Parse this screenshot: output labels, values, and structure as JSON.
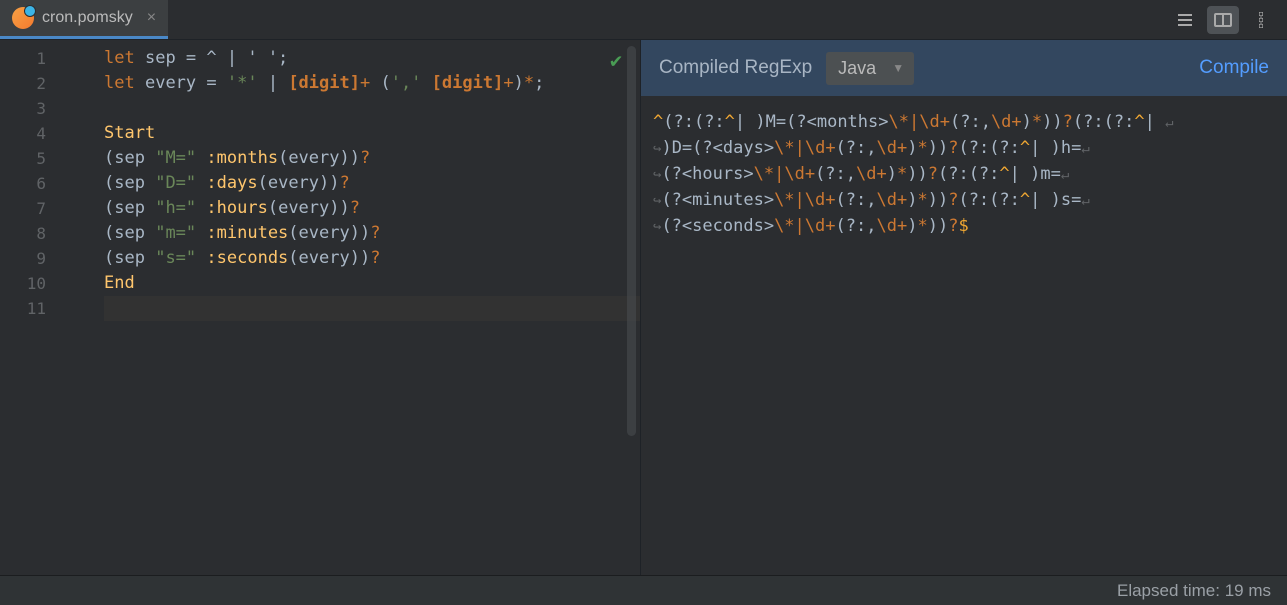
{
  "tab": {
    "filename": "cron.pomsky"
  },
  "editor": {
    "line_count": 11,
    "lines": {
      "l1": {
        "kw": "let",
        "id": "sep",
        "eq": " = ",
        "rest": "^ | ' ';"
      },
      "l2": {
        "kw": "let",
        "id": "every",
        "eq": " = ",
        "lit": "'*'",
        "pipe": " | ",
        "c1": "[digit]",
        "plus1": "+ ",
        "paren_open": "(",
        "comma_lit": "','",
        "sp": " ",
        "c2": "[digit]",
        "plus2": "+",
        "paren_close": ")",
        "star": "*",
        "semi": ";"
      },
      "l4": {
        "start": "Start"
      },
      "l5": {
        "open": "(",
        "sep": "sep ",
        "lit": "\"M=\"",
        "sp": " ",
        "call": ":months",
        "po": "(",
        "arg": "every",
        "pc": ")",
        "close": ")",
        "q": "?"
      },
      "l6": {
        "open": "(",
        "sep": "sep ",
        "lit": "\"D=\"",
        "sp": " ",
        "call": ":days",
        "po": "(",
        "arg": "every",
        "pc": ")",
        "close": ")",
        "q": "?"
      },
      "l7": {
        "open": "(",
        "sep": "sep ",
        "lit": "\"h=\"",
        "sp": " ",
        "call": ":hours",
        "po": "(",
        "arg": "every",
        "pc": ")",
        "close": ")",
        "q": "?"
      },
      "l8": {
        "open": "(",
        "sep": "sep ",
        "lit": "\"m=\"",
        "sp": " ",
        "call": ":minutes",
        "po": "(",
        "arg": "every",
        "pc": ")",
        "close": ")",
        "q": "?"
      },
      "l9": {
        "open": "(",
        "sep": "sep ",
        "lit": "\"s=\"",
        "sp": " ",
        "call": ":seconds",
        "po": "(",
        "arg": "every",
        "pc": ")",
        "close": ")",
        "q": "?"
      },
      "l10": {
        "end": "End"
      }
    }
  },
  "right": {
    "label": "Compiled RegExp",
    "flavor": "Java",
    "compile": "Compile"
  },
  "regex": {
    "l1": {
      "a1": "^",
      "g1": "(?:(?:",
      "a2": "^",
      "g2": "| )",
      "lit_m": "M=",
      "g3": "(?<",
      "nm": "months",
      "g4": ">",
      "esc1": "\\*",
      "alt1": "|",
      "esc2": "\\d",
      "op1": "+",
      "g5": "(?:,",
      "esc3": "\\d",
      "op2": "+",
      "g6": ")",
      "op3": "*",
      "g7": "))",
      "op4": "?",
      "g8": "(?:(?:",
      "a3": "^",
      "g9": "| ",
      "wrap": "↵"
    },
    "l2": {
      "cont": "↪",
      "g1": ")",
      "lit_d": "D=",
      "g2": "(?<",
      "nm": "days",
      "g3": ">",
      "esc1": "\\*",
      "alt1": "|",
      "esc2": "\\d",
      "op1": "+",
      "g4": "(?:,",
      "esc3": "\\d",
      "op2": "+",
      "g5": ")",
      "op3": "*",
      "g6": "))",
      "op4": "?",
      "g7": "(?:(?:",
      "a1": "^",
      "g8": "| )",
      "lit_h": "h=",
      "wrap": "↵"
    },
    "l3": {
      "cont": "↪",
      "g1": "(?<",
      "nm": "hours",
      "g2": ">",
      "esc1": "\\*",
      "alt1": "|",
      "esc2": "\\d",
      "op1": "+",
      "g3": "(?:,",
      "esc3": "\\d",
      "op2": "+",
      "g4": ")",
      "op3": "*",
      "g5": "))",
      "op4": "?",
      "g6": "(?:(?:",
      "a1": "^",
      "g7": "| )",
      "lit_m": "m=",
      "wrap": "↵"
    },
    "l4": {
      "cont": "↪",
      "g1": "(?<",
      "nm": "minutes",
      "g2": ">",
      "esc1": "\\*",
      "alt1": "|",
      "esc2": "\\d",
      "op1": "+",
      "g3": "(?:,",
      "esc3": "\\d",
      "op2": "+",
      "g4": ")",
      "op3": "*",
      "g5": "))",
      "op4": "?",
      "g6": "(?:(?:",
      "a1": "^",
      "g7": "| )",
      "lit_s": "s=",
      "wrap": "↵"
    },
    "l5": {
      "cont": "↪",
      "g1": "(?<",
      "nm": "seconds",
      "g2": ">",
      "esc1": "\\*",
      "alt1": "|",
      "esc2": "\\d",
      "op1": "+",
      "g3": "(?:,",
      "esc3": "\\d",
      "op2": "+",
      "g4": ")",
      "op3": "*",
      "g5": "))",
      "op4": "?",
      "a2": "$"
    }
  },
  "status": {
    "elapsed": "Elapsed time: 19 ms"
  }
}
